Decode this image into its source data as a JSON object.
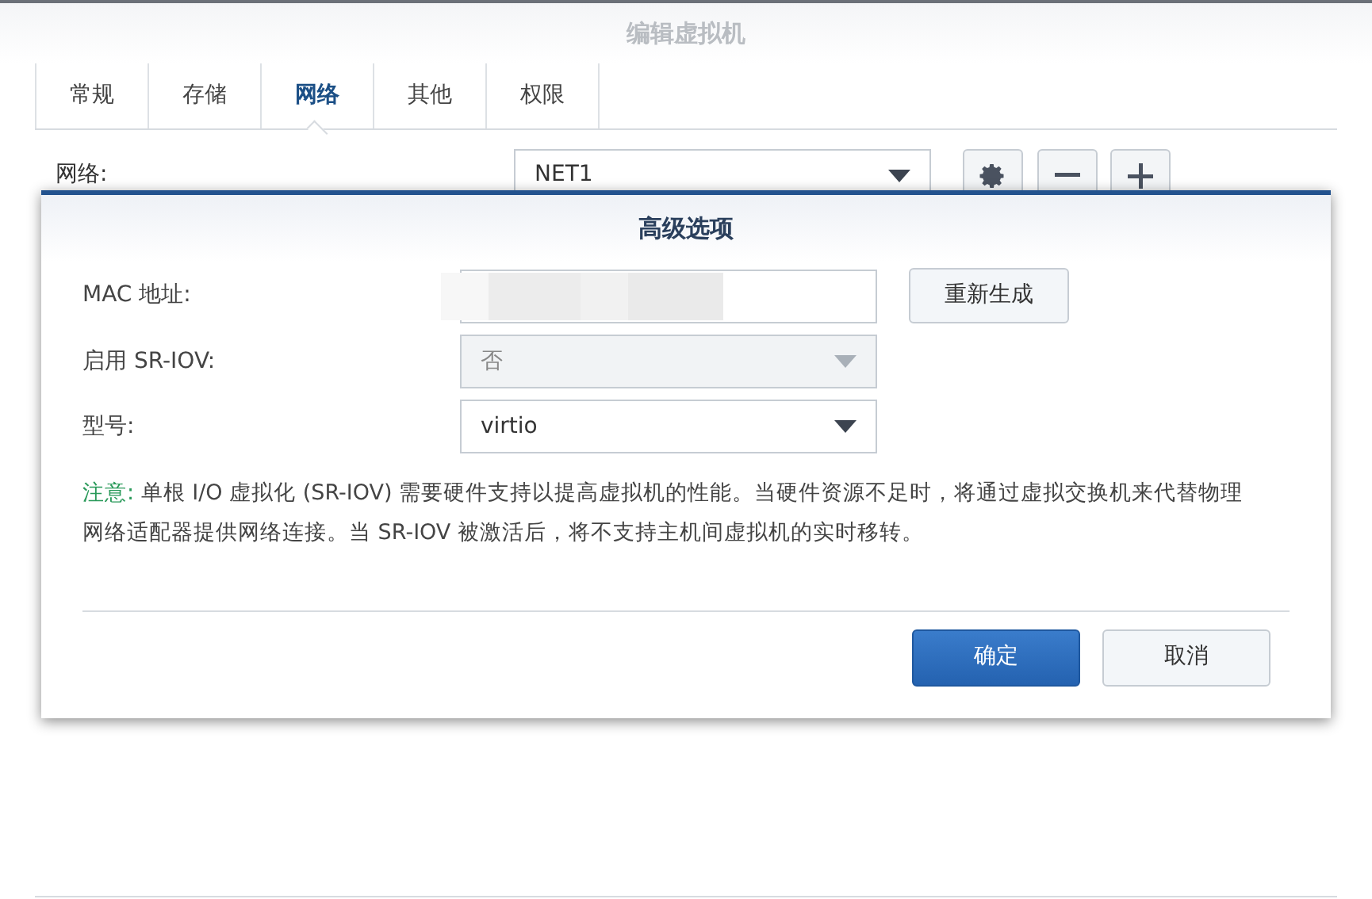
{
  "window": {
    "title": "编辑虚拟机"
  },
  "tabs": [
    {
      "label": "常规",
      "selected": false
    },
    {
      "label": "存储",
      "selected": false
    },
    {
      "label": "网络",
      "selected": true
    },
    {
      "label": "其他",
      "selected": false
    },
    {
      "label": "权限",
      "selected": false
    }
  ],
  "network": {
    "label": "网络:",
    "value": "NET1"
  },
  "dialog": {
    "title": "高级选项",
    "fields": [
      {
        "kind": "text",
        "label": "MAC 地址:",
        "button": "重新生成"
      },
      {
        "kind": "select",
        "label": "启用 SR-IOV:",
        "value": "否",
        "disabled": true
      },
      {
        "kind": "select",
        "label": "型号:",
        "value": "virtio",
        "disabled": false
      }
    ],
    "note": {
      "label": "注意:",
      "text": "单根 I/O 虚拟化 (SR-IOV) 需要硬件支持以提高虚拟机的性能。当硬件资源不足时，将通过虚拟交换机来代替物理网络适配器提供网络连接。当 SR-IOV 被激活后，将不支持主机间虚拟机的实时移转。"
    },
    "buttons": [
      {
        "label": "确定",
        "kind": "primary"
      },
      {
        "label": "取消",
        "kind": "secondary"
      }
    ]
  }
}
